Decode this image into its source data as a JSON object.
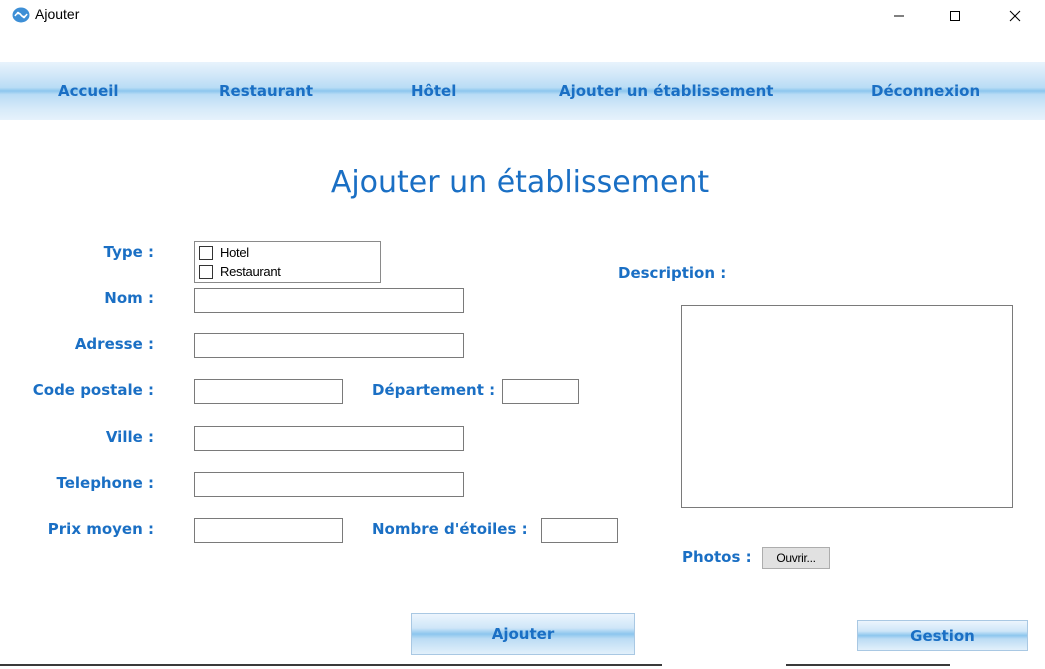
{
  "window": {
    "title": "Ajouter",
    "controls": {
      "minimize": "minimize-icon",
      "maximize": "maximize-icon",
      "close": "close-icon"
    }
  },
  "nav": {
    "items": [
      {
        "label": "Accueil"
      },
      {
        "label": "Restaurant"
      },
      {
        "label": "Hôtel"
      },
      {
        "label": "Ajouter un établissement"
      },
      {
        "label": "Déconnexion"
      }
    ]
  },
  "page": {
    "title": "Ajouter un établissement"
  },
  "form": {
    "type_label": "Type :",
    "type_options": [
      {
        "label": "Hotel",
        "checked": false
      },
      {
        "label": "Restaurant",
        "checked": false
      }
    ],
    "nom_label": "Nom :",
    "nom_value": "",
    "adresse_label": "Adresse :",
    "adresse_value": "",
    "code_postale_label": "Code postale :",
    "code_postale_value": "",
    "departement_label": "Département :",
    "departement_value": "",
    "ville_label": "Ville :",
    "ville_value": "",
    "telephone_label": "Telephone :",
    "telephone_value": "",
    "prix_moyen_label": "Prix moyen :",
    "prix_moyen_value": "",
    "nombre_etoiles_label": "Nombre d'étoiles :",
    "nombre_etoiles_value": "",
    "description_label": "Description :",
    "description_value": "",
    "photos_label": "Photos :",
    "ouvrir_label": "Ouvrir..."
  },
  "actions": {
    "ajouter_label": "Ajouter",
    "gestion_label": "Gestion"
  },
  "colors": {
    "accent": "#1a6fc4",
    "nav_gradient_mid": "#8cc6ee"
  }
}
